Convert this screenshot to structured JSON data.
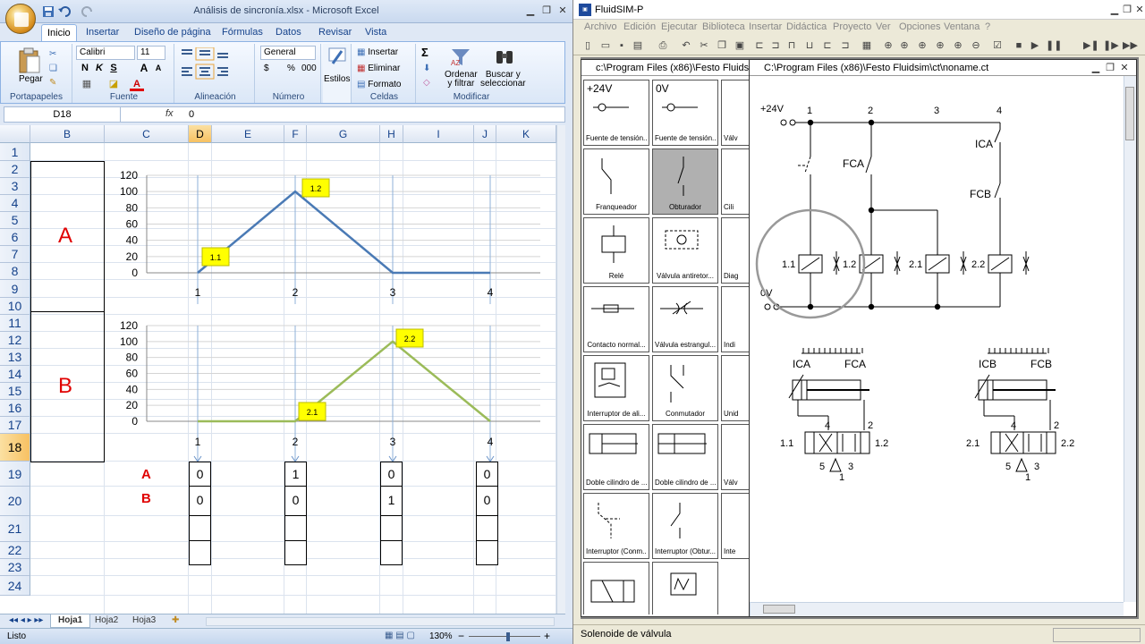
{
  "excel": {
    "window_title": "Análisis de sincronía.xlsx - Microsoft Excel",
    "tabs": [
      "Inicio",
      "Insertar",
      "Diseño de página",
      "Fórmulas",
      "Datos",
      "Revisar",
      "Vista"
    ],
    "clipboard": {
      "paste_label": "Pegar",
      "group": "Portapapeles"
    },
    "font": {
      "name": "Calibri",
      "size": "11",
      "group": "Fuente",
      "bold": "N",
      "italic": "K",
      "underline": "S",
      "grow": "A",
      "shrink": "A",
      "font_color_glyph": "A"
    },
    "alignment": {
      "group": "Alineación"
    },
    "number": {
      "format": "General",
      "group": "Número",
      "currency": "$",
      "percent": "%",
      "thousands": "000"
    },
    "styles": {
      "label": "Estilos"
    },
    "cells": {
      "insert": "Insertar",
      "delete": "Eliminar",
      "format": "Formato",
      "group": "Celdas"
    },
    "modify": {
      "sort": "Ordenar\ny filtrar",
      "find": "Buscar y\nseleccionar",
      "group": "Modificar",
      "sum": "Σ"
    },
    "formula_bar": {
      "name_box": "D18",
      "fx": "fx",
      "value": "0"
    },
    "columns": [
      "B",
      "C",
      "D",
      "E",
      "F",
      "G",
      "H",
      "I",
      "J",
      "K"
    ],
    "selected_column": "D",
    "rows": [
      "1",
      "2",
      "3",
      "4",
      "5",
      "6",
      "7",
      "8",
      "9",
      "10",
      "11",
      "12",
      "13",
      "14",
      "15",
      "16",
      "17",
      "18",
      "19",
      "20",
      "21",
      "22",
      "23",
      "24"
    ],
    "selected_row": "18",
    "cylinder_labels": {
      "big_a": "A",
      "big_b": "B",
      "small_a": "A",
      "small_b": "B"
    },
    "table_values": {
      "row_a": [
        "0",
        "1",
        "0",
        "0"
      ],
      "row_b": [
        "0",
        "0",
        "1",
        "0"
      ]
    },
    "sheets": [
      "Hoja1",
      "Hoja2",
      "Hoja3"
    ],
    "active_sheet": "Hoja1",
    "status_text": "Listo",
    "zoom": "130%",
    "zoom_minus": "−",
    "zoom_plus": "+"
  },
  "chart_data": [
    {
      "type": "line",
      "x": [
        1,
        2,
        3,
        4
      ],
      "series": [
        {
          "values": [
            0,
            100,
            0,
            0
          ]
        }
      ],
      "ylim": [
        0,
        120
      ],
      "yticks": [
        "120",
        "100",
        "80",
        "60",
        "40",
        "20",
        "0"
      ],
      "xticks": [
        "1",
        "2",
        "3",
        "4"
      ],
      "annotations": [
        "1.1",
        "1.2"
      ],
      "line_color": "#4a7ab5",
      "grid": true
    },
    {
      "type": "line",
      "x": [
        1,
        2,
        3,
        4
      ],
      "series": [
        {
          "values": [
            0,
            0,
            100,
            0
          ]
        }
      ],
      "ylim": [
        0,
        120
      ],
      "yticks": [
        "120",
        "100",
        "80",
        "60",
        "40",
        "20",
        "0"
      ],
      "xticks": [
        "1",
        "2",
        "3",
        "4"
      ],
      "annotations": [
        "2.1",
        "2.2"
      ],
      "line_color": "#9bbb59",
      "grid": true
    }
  ],
  "fluidsim": {
    "window_title": "FluidSIM-P",
    "menu": [
      "Archivo",
      "Edición",
      "Ejecutar",
      "Biblioteca",
      "Insertar",
      "Didáctica",
      "Proyecto",
      "Ver",
      "Opciones",
      "Ventana",
      "?"
    ],
    "library_window_title": "c:\\Program Files (x86)\\Festo Fluidsim\\",
    "circuit_window_title": "C:\\Program Files (x86)\\Festo Fluidsim\\ct\\noname.ct",
    "library": [
      {
        "top": "+24V",
        "caption": "Fuente de tensión..."
      },
      {
        "top": "0V",
        "caption": "Fuente de tensión..."
      },
      {
        "top": "",
        "caption": "Franqueador"
      },
      {
        "top": "",
        "caption": "Obturador"
      },
      {
        "top": "",
        "caption": "Relé"
      },
      {
        "top": "",
        "caption": "Válvula antiretor..."
      },
      {
        "top": "",
        "caption": "Contacto normal..."
      },
      {
        "top": "",
        "caption": "Válvula estrangul..."
      },
      {
        "top": "",
        "caption": "Interruptor de ali..."
      },
      {
        "top": "",
        "caption": "Conmutador"
      },
      {
        "top": "",
        "caption": "Doble cilindro de ..."
      },
      {
        "top": "",
        "caption": "Doble cilindro de ..."
      },
      {
        "top": "",
        "caption": "Interruptor (Conm..."
      },
      {
        "top": "",
        "caption": "Interruptor (Obtur..."
      },
      {
        "top": "",
        "caption": ""
      },
      {
        "top": "",
        "caption": ""
      }
    ],
    "library_partial": [
      "Válv",
      "Cili",
      "Diag",
      "Indi",
      "Unid",
      "Válv",
      "Inte"
    ],
    "circuit": {
      "plus24": "+24V",
      "zero_v": "0V",
      "columns": [
        "1",
        "2",
        "3",
        "4"
      ],
      "switches": [
        "FCA",
        "ICA",
        "FCB"
      ],
      "solenoids": [
        "1.1",
        "1.2",
        "2.1",
        "2.2"
      ],
      "cyl_a": {
        "left": "ICA",
        "right": "FCA",
        "p4": "4",
        "p2": "2",
        "s1": "1.1",
        "s2": "1.2",
        "p5": "5",
        "p3": "3",
        "p1": "1"
      },
      "cyl_b": {
        "left": "ICB",
        "right": "FCB",
        "p4": "4",
        "p2": "2",
        "s1": "2.1",
        "s2": "2.2",
        "p5": "5",
        "p3": "3",
        "p1": "1"
      }
    },
    "status_text": "Solenoide de válvula"
  }
}
